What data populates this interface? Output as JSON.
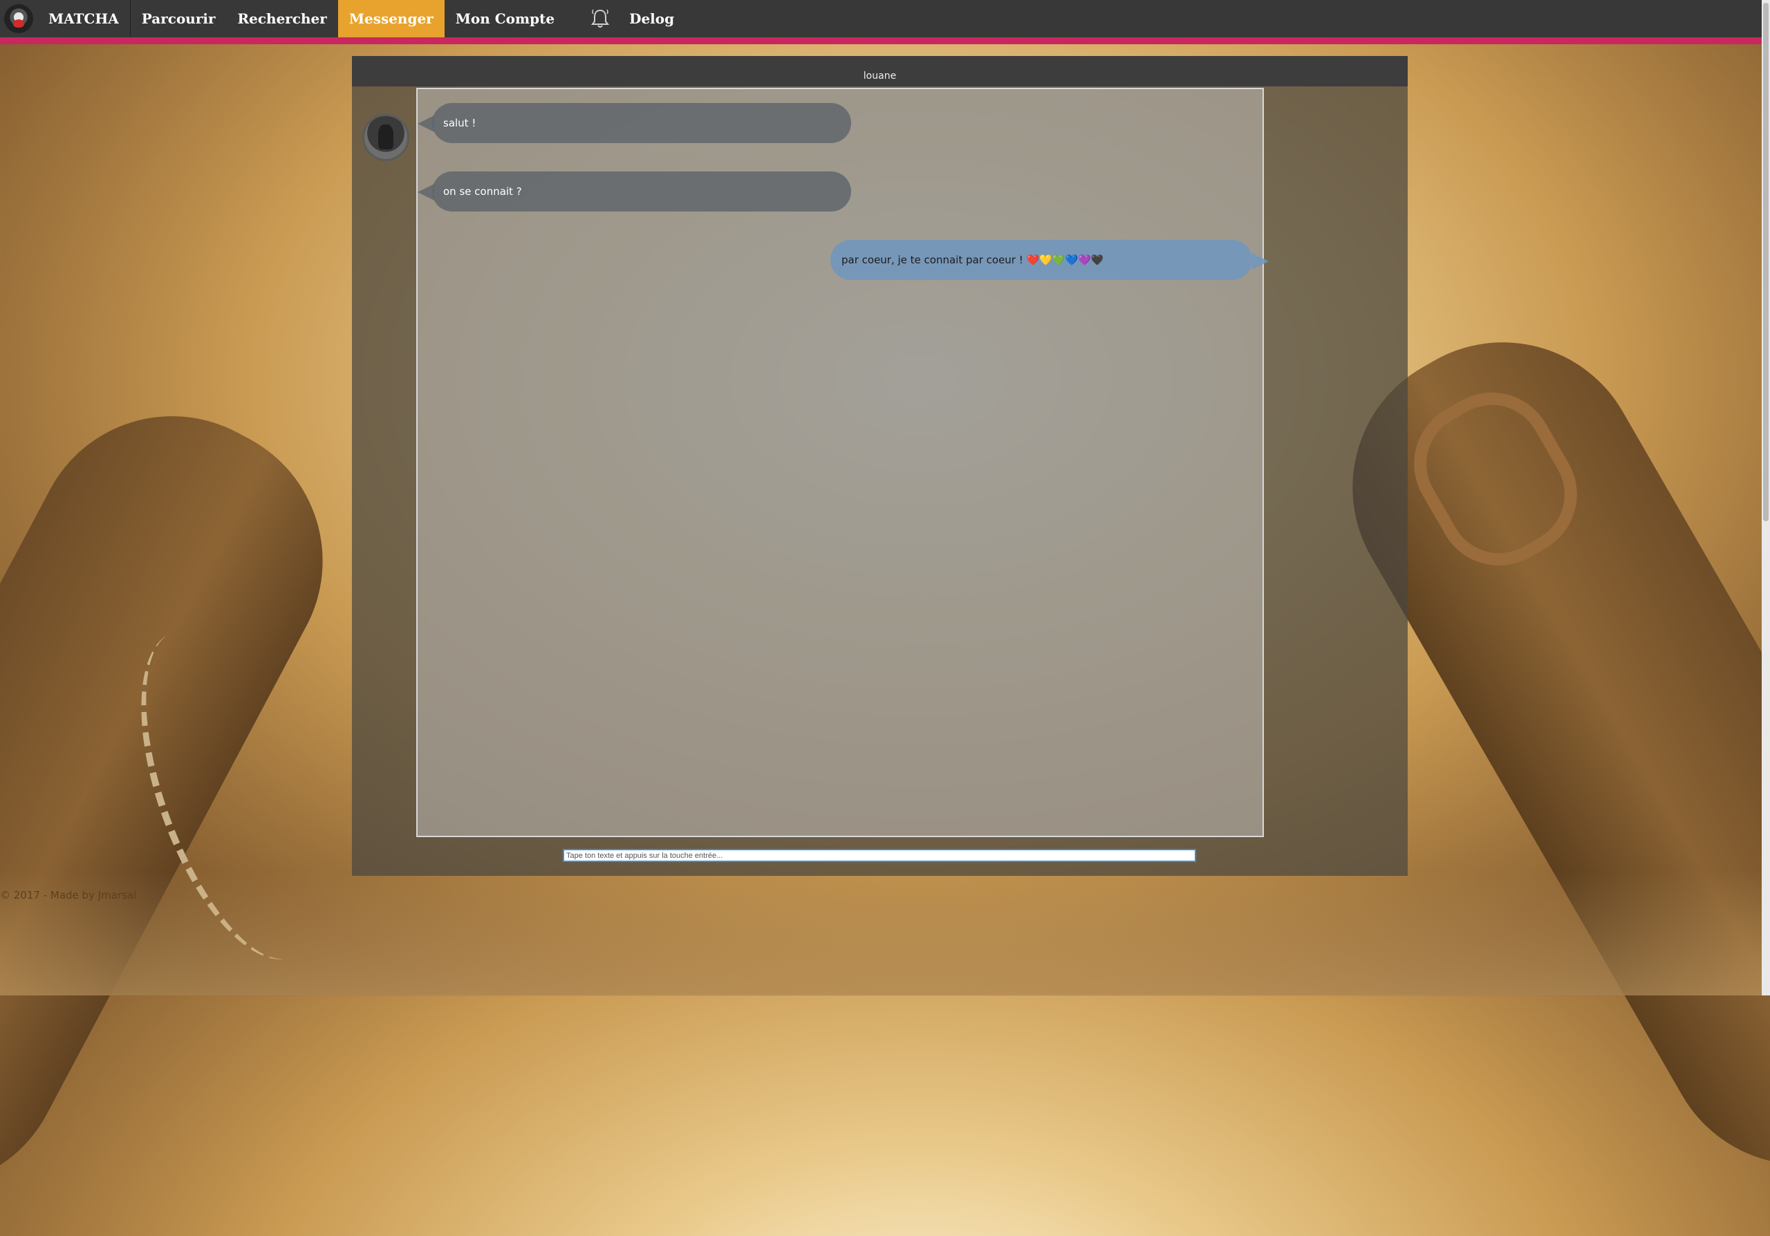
{
  "navbar": {
    "brand": "MATCHA",
    "items": [
      {
        "label": "Parcourir"
      },
      {
        "label": "Rechercher"
      },
      {
        "label": "Messenger"
      },
      {
        "label": "Mon Compte"
      }
    ],
    "logout": "Delog",
    "active_color": "#e8a32e",
    "accent_color": "#c8285f"
  },
  "chat": {
    "contact_name": "louane",
    "messages": [
      {
        "from": "them",
        "text": "salut !"
      },
      {
        "from": "them",
        "text": "on se connait ?"
      },
      {
        "from": "me",
        "text": "par coeur, je te connait par coeur ! ❤️💛💚💙💜🖤"
      }
    ],
    "input_placeholder": "Tape ton texte et appuis sur la touche entrée..."
  },
  "footer": {
    "text": "© 2017 - Made by Jmarsal"
  }
}
